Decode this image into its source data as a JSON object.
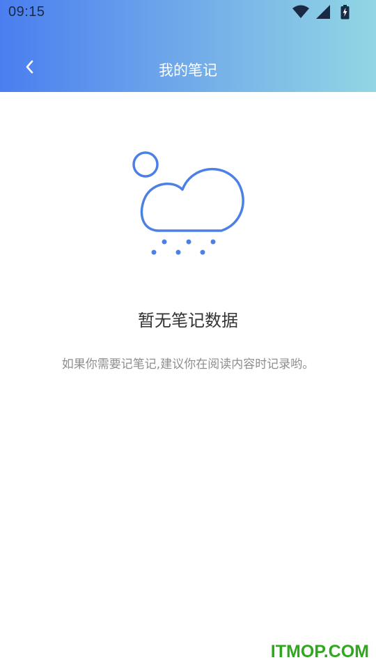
{
  "status_bar": {
    "time": "09:15",
    "icons": [
      "wifi-icon",
      "cell-signal-icon",
      "battery-charging-icon"
    ]
  },
  "header": {
    "back_icon": "chevron-left-icon",
    "title": "我的笔记"
  },
  "empty_state": {
    "illustration": "cloud-rain-icon",
    "title": "暂无笔记数据",
    "hint": "如果你需要记笔记,建议你在阅读内容时记录哟。"
  },
  "watermark": {
    "text": "ITMOP.COM"
  },
  "colors": {
    "header_gradient_start": "#4a7ef0",
    "header_gradient_end": "#92d6e4",
    "illustration_stroke": "#4d80e6",
    "watermark": "#2fa81e"
  }
}
